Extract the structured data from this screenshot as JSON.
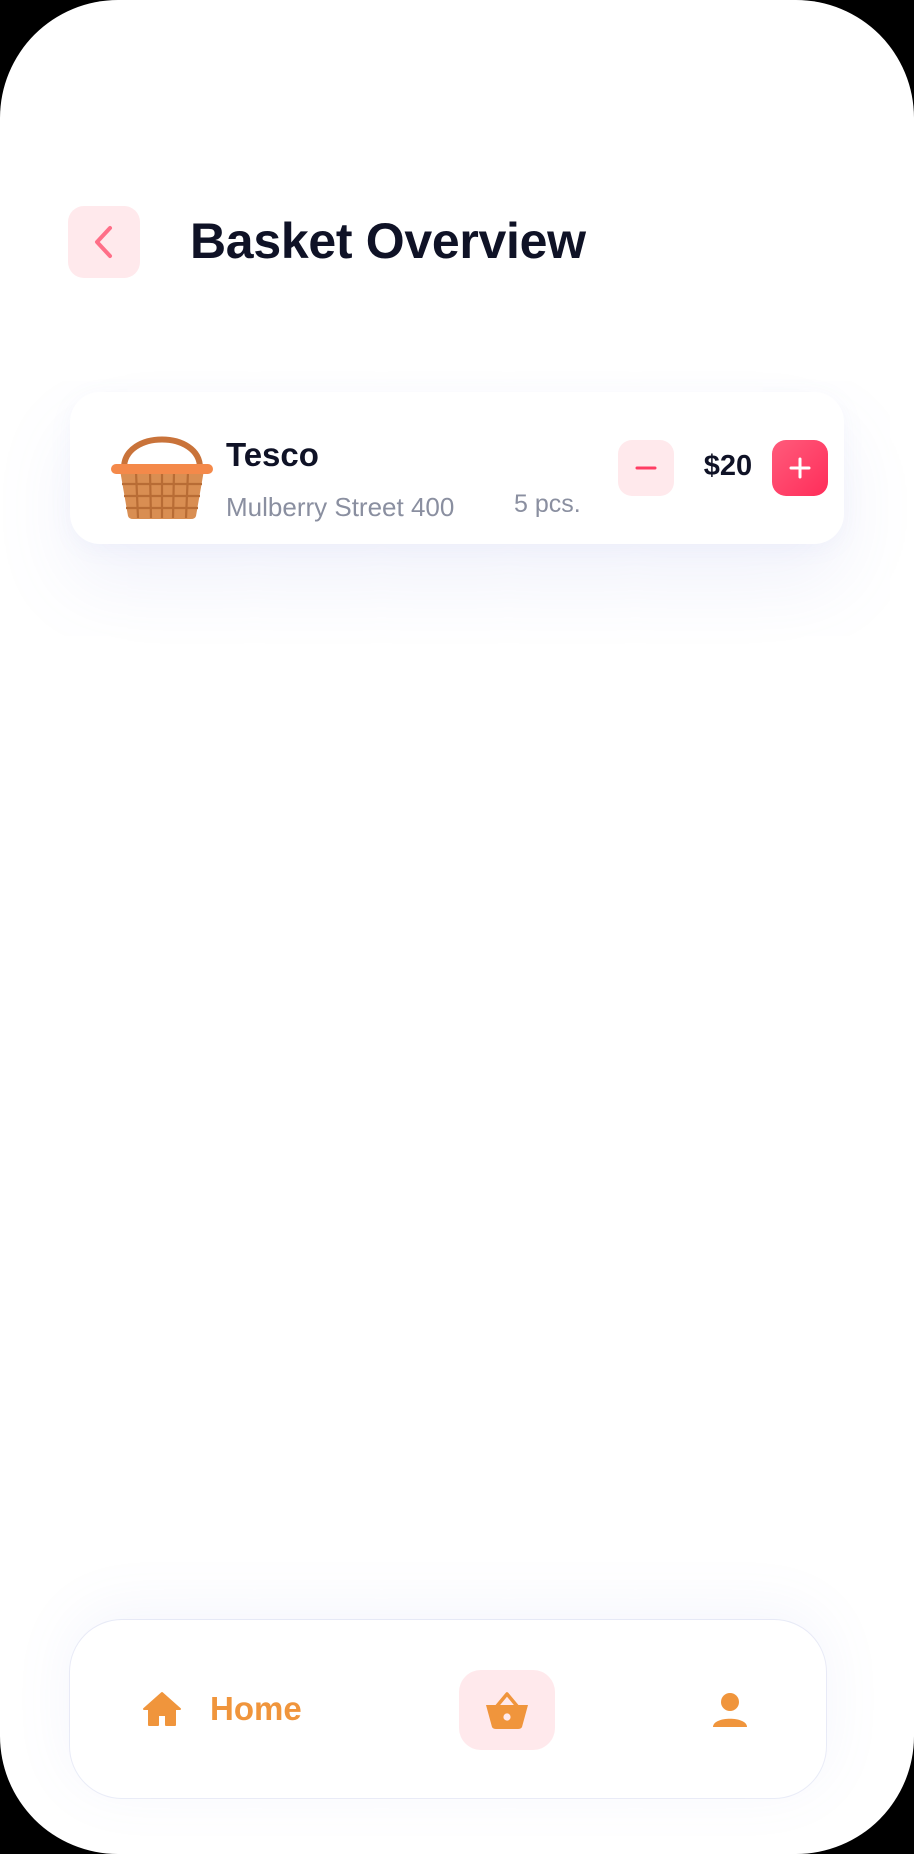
{
  "header": {
    "title": "Basket Overview",
    "back_icon": "chevron-left-icon"
  },
  "basket_items": [
    {
      "store": "Tesco",
      "address": "Mulberry Street 400",
      "quantity": "5 pcs.",
      "price": "$20",
      "image": "wicker-basket-icon"
    }
  ],
  "bottom_nav": {
    "items": [
      {
        "label": "Home",
        "icon": "home-icon",
        "active": true
      },
      {
        "label": "",
        "icon": "basket-icon",
        "highlighted": true
      },
      {
        "label": "",
        "icon": "user-icon"
      }
    ]
  },
  "colors": {
    "accent_pink": "#ff2d5a",
    "pink_soft": "#ffe9ec",
    "accent_orange": "#f0953c",
    "text_dark": "#0f1226",
    "text_muted": "#8a8fa0"
  }
}
